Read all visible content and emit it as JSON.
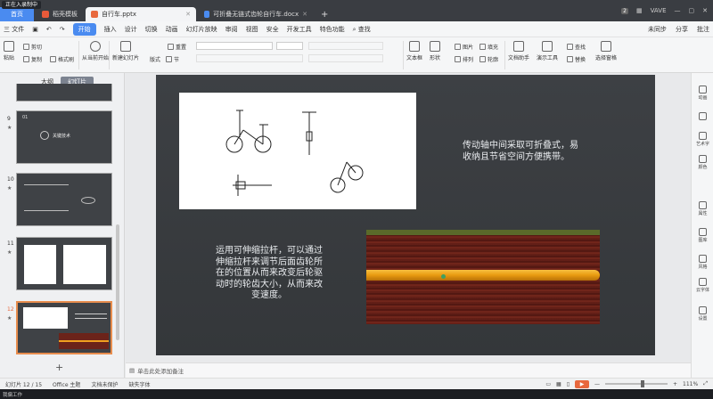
{
  "overlay_label": "正在入录制中",
  "tabs": [
    {
      "label": "首页"
    },
    {
      "label": "稻壳模板"
    },
    {
      "label": "自行车.pptx"
    },
    {
      "label": "可折叠无链式齿轮自行车.docx"
    }
  ],
  "window": {
    "badge": "2",
    "user": "VAVE"
  },
  "menu": {
    "file": "三 文件",
    "items": [
      "开始",
      "插入",
      "设计",
      "切换",
      "动画",
      "幻灯片放映",
      "审阅",
      "视图",
      "安全",
      "开发工具",
      "特色功能"
    ],
    "search": "查找",
    "unsync": "未同步",
    "share": "分享",
    "comment": "批注"
  },
  "toolbar": {
    "paste": "粘贴",
    "cut": "剪切",
    "copy": "复制",
    "format_painter": "格式刷",
    "play_current": "从当前开始",
    "new_slide": "新建幻灯片",
    "layout": "版式",
    "section": "节",
    "reset": "重置",
    "textbox": "文本框",
    "shape": "形状",
    "arrange": "排列",
    "outline": "轮廓",
    "picture": "图片",
    "fill": "填充",
    "doc_assist": "文档助手",
    "present_tools": "演示工具",
    "find": "查找",
    "replace": "替换",
    "select_pane": "选择窗格"
  },
  "left_panel": {
    "tab_outline": "大纲",
    "tab_slides": "幻灯片",
    "add": "+",
    "thumbs": [
      {
        "num": "9",
        "title": "关键技术"
      },
      {
        "num": "10",
        "title": ""
      },
      {
        "num": "11",
        "title": ""
      },
      {
        "num": "12",
        "title": ""
      }
    ]
  },
  "slide": {
    "text1": "传动轴中间采取可折叠式，易收纳且节省空间方便携带。",
    "text2": "运用可伸缩拉杆，可以通过伸缩拉杆来调节后面齿轮所在的位置从而来改变后轮驱动时的轮齿大小，从而来改变速度。"
  },
  "right_bar": [
    "动画",
    "艺术字",
    "颜色",
    "属性",
    "图库",
    "风格",
    "云字体",
    "设置"
  ],
  "notes": {
    "placeholder": "单击此处添加备注"
  },
  "status": {
    "slide": "幻灯片 12 / 15",
    "theme": "Office 主题",
    "protect": "文档未保护",
    "font_missing": "缺失字体",
    "zoom": "111%"
  },
  "taskbar": {
    "text": "我偏工作"
  }
}
